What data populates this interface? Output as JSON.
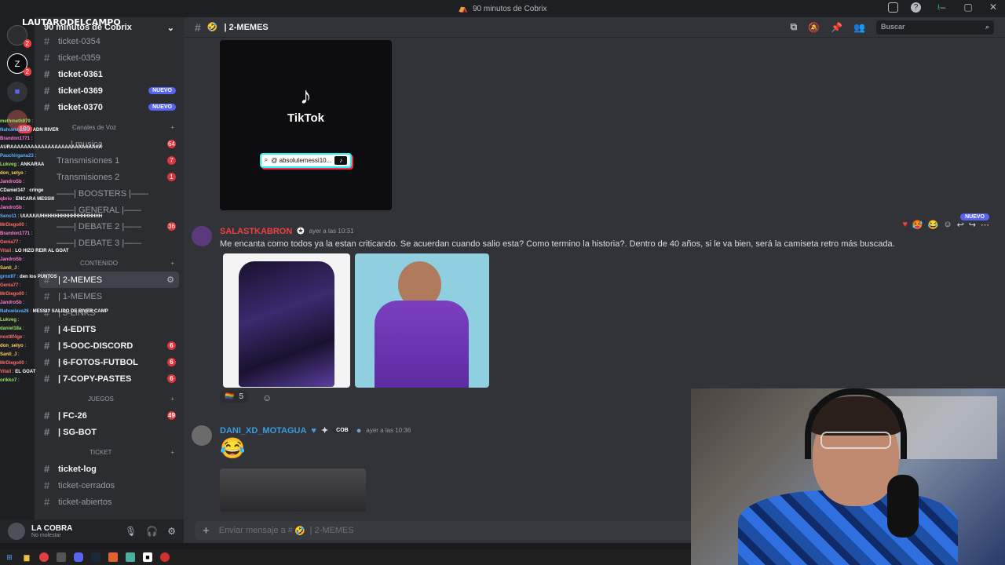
{
  "window": {
    "title": "90 minutos de Cobrix"
  },
  "overlay": {
    "streamer_tag": "LAUTARODELCAMPO"
  },
  "server": {
    "name": "90 minutos de Cobrix"
  },
  "server_badges": [
    "2",
    "2",
    "190"
  ],
  "channels_top": [
    {
      "name": "ticket-0354",
      "bold": false
    },
    {
      "name": "ticket-0359",
      "bold": false
    },
    {
      "name": "ticket-0361",
      "bold": true
    },
    {
      "name": "ticket-0369",
      "bold": true,
      "pill": "NUEVO"
    },
    {
      "name": "ticket-0370",
      "bold": true,
      "pill": "NUEVO"
    }
  ],
  "voice_category": "Canales de Voz",
  "voice_channels": [
    {
      "name": "| musica",
      "count": "64"
    },
    {
      "name": "Transmisiones 1",
      "count": "7"
    },
    {
      "name": "Transmisiones 2",
      "count": "1"
    },
    {
      "name": "——| BOOSTERS |——",
      "count": ""
    },
    {
      "name": "——| GENERAL |——",
      "count": ""
    },
    {
      "name": "——| DEBATE 2 |——",
      "count": "36"
    },
    {
      "name": "——| DEBATE 3 |——",
      "count": ""
    }
  ],
  "content_category": "CONTENIDO",
  "content_channels": [
    {
      "name": "| 2-MEMES",
      "selected": true,
      "count": ""
    },
    {
      "name": "| 1-MEMES",
      "selected": false,
      "count": ""
    },
    {
      "name": "| 3-LINKS",
      "selected": false,
      "count": ""
    },
    {
      "name": "| 4-EDITS",
      "selected": false,
      "count": ""
    },
    {
      "name": "| 5-OOC-DISCORD",
      "selected": false,
      "count": "6"
    },
    {
      "name": "| 6-FOTOS-FUTBOL",
      "selected": false,
      "count": "6"
    },
    {
      "name": "| 7-COPY-PASTES",
      "selected": false,
      "count": "6"
    }
  ],
  "games_category": "JUEGOS",
  "games_channels": [
    {
      "name": "| FC-26",
      "count": "49"
    },
    {
      "name": "| SG-BOT",
      "count": ""
    }
  ],
  "ticket_category": "TICKET",
  "ticket_channels": [
    {
      "name": "ticket-log",
      "bold": true
    },
    {
      "name": "ticket-cerrados",
      "bold": false
    },
    {
      "name": "ticket-abiertos",
      "bold": false
    }
  ],
  "stream_chat": [
    {
      "user": "methmeth979",
      "msg": "",
      "color": "#9be15d"
    },
    {
      "user": "Nahuelava26",
      "msg": "ADN RIVER",
      "color": "#5db0ff"
    },
    {
      "user": "Brandon1771",
      "msg": "",
      "color": "#ff7ad9"
    },
    {
      "user": "",
      "msg": "AURAAAAAAAAAAAAAAAAAAAAAAAAAAA",
      "color": "#ffffff"
    },
    {
      "user": "Pauchirgana23",
      "msg": "",
      "color": "#5db0ff"
    },
    {
      "user": "Lukveg",
      "msg": "ANKARAA",
      "color": "#9be15d"
    },
    {
      "user": "don_selyo",
      "msg": "",
      "color": "#ffd15d"
    },
    {
      "user": "JandroSb",
      "msg": "",
      "color": "#ff7ad9"
    },
    {
      "user": "CDaniel147",
      "msg": "cringe",
      "color": "#ffffff"
    },
    {
      "user": "qbrio",
      "msg": "ENCARA MESSIII",
      "color": "#ff7ad9"
    },
    {
      "user": "JandroSb",
      "msg": "",
      "color": "#ff7ad9"
    },
    {
      "user": "Seno11",
      "msg": "UUUUUUHHHHHHHHHHHHHHHHHH",
      "color": "#5db0ff"
    },
    {
      "user": "MrDiego00",
      "msg": "",
      "color": "#ff6b6b"
    },
    {
      "user": "Brandon1771",
      "msg": "",
      "color": "#ff7ad9"
    },
    {
      "user": "Genia77",
      "msg": "",
      "color": "#ff6b6b"
    },
    {
      "user": "Vitali",
      "msg": "LO HIZO REIR AL GOAT",
      "color": "#ff6b6b"
    },
    {
      "user": "JandroSb",
      "msg": "",
      "color": "#ff7ad9"
    },
    {
      "user": "Santi_J",
      "msg": "",
      "color": "#ffd15d"
    },
    {
      "user": "grnn97",
      "msg": "den los PUNTOS",
      "color": "#5db0ff"
    },
    {
      "user": "Genia77",
      "msg": "",
      "color": "#ff6b6b"
    },
    {
      "user": "MrDiego00",
      "msg": "",
      "color": "#ff6b6b"
    },
    {
      "user": "JandroSb",
      "msg": "",
      "color": "#ff7ad9"
    },
    {
      "user": "Nahuelava26",
      "msg": "MESSI? SALIDO DE RIVER CAMP",
      "color": "#5db0ff"
    },
    {
      "user": "Lukveg",
      "msg": "",
      "color": "#9be15d"
    },
    {
      "user": "daniel18a",
      "msg": "",
      "color": "#9be15d"
    },
    {
      "user": "noxt8f4ge",
      "msg": "",
      "color": "#ff6b6b"
    },
    {
      "user": "don_selyo",
      "msg": "",
      "color": "#ffd15d"
    },
    {
      "user": "Santi_J",
      "msg": "",
      "color": "#ffd15d"
    },
    {
      "user": "MrDiego00",
      "msg": "",
      "color": "#ff6b6b"
    },
    {
      "user": "Vitali",
      "msg": "EL GOAT",
      "color": "#ff6b6b"
    },
    {
      "user": "orikko7",
      "msg": "",
      "color": "#9be15d"
    }
  ],
  "user": {
    "name": "LA COBRA",
    "status": "No molestar"
  },
  "channel": {
    "name": "| 2-MEMES"
  },
  "search": {
    "placeholder": "Buscar"
  },
  "tiktok": {
    "brand": "TikTok",
    "handle": "@ absolutemessi10..."
  },
  "messages": [
    {
      "author": "SALASTKABRON",
      "author_color": "#f23f43",
      "time": "ayer a las 10:31",
      "text": "Me encanta como todos ya la estan criticando. Se acuerdan cuando salio esta? Como termino la historia?. Dentro de 40 años, si le va bien, será la camiseta retro más buscada.",
      "reaction_count": "5"
    },
    {
      "author": "DANI_XD_MOTAGUA",
      "author_color": "#3b9dde",
      "tag": "COB",
      "time": "ayer a las 10:36",
      "emoji": "😂"
    }
  ],
  "new_label": "NUEVO",
  "composer": {
    "placeholder": "Enviar mensaje a #",
    "channel": "| 2-MEMES"
  }
}
